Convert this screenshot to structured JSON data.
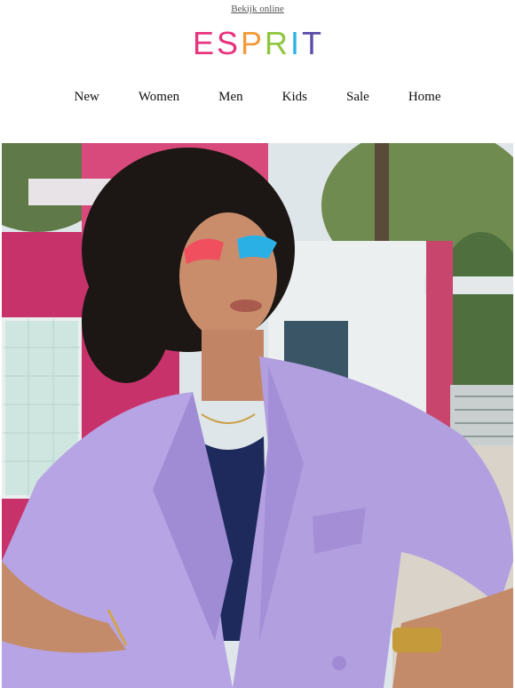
{
  "header": {
    "view_online": "Bekijk online"
  },
  "logo": {
    "letters": [
      "E",
      "S",
      "P",
      "R",
      "I",
      "T"
    ],
    "colors": [
      "#e8327c",
      "#e8327c",
      "#f29a3a",
      "#8fc63f",
      "#2ab3e8",
      "#5b4aa6"
    ]
  },
  "nav": {
    "items": [
      "New",
      "Women",
      "Men",
      "Kids",
      "Sale",
      "Home"
    ]
  },
  "hero": {
    "alt": "Model in lilac blazer with colorful eye makeup"
  }
}
